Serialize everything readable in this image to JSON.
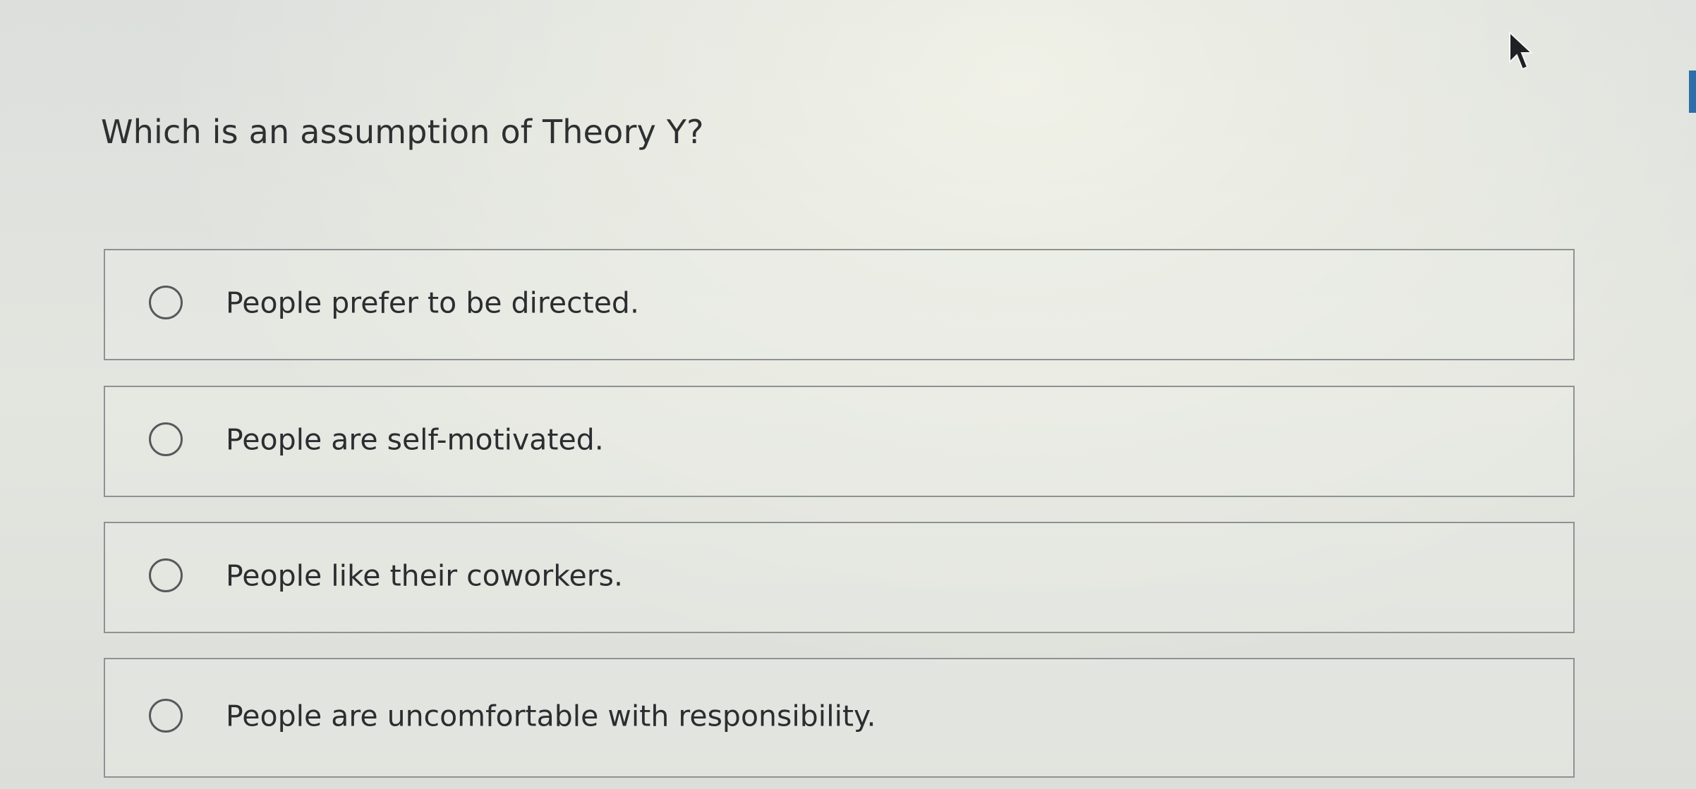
{
  "question": {
    "text": "Which is an assumption of Theory Y?"
  },
  "options": [
    {
      "label": "People prefer to be directed.",
      "selected": false
    },
    {
      "label": "People are self-motivated.",
      "selected": false
    },
    {
      "label": "People like their coworkers.",
      "selected": false
    },
    {
      "label": "People are uncomfortable with responsibility.",
      "selected": false
    }
  ],
  "icons": {
    "cursor": "mouse-pointer-icon",
    "radio": "radio-circle-icon"
  },
  "colors": {
    "border": "#8f9293",
    "text": "#2b2d30",
    "accent": "#2f6ea8"
  }
}
